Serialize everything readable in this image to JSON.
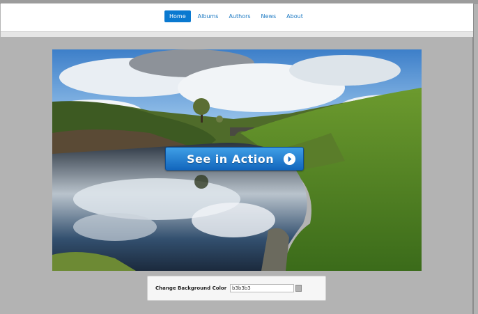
{
  "nav": {
    "items": [
      {
        "label": "Home",
        "active": true
      },
      {
        "label": "Albums",
        "active": false
      },
      {
        "label": "Authors",
        "active": false
      },
      {
        "label": "News",
        "active": false
      },
      {
        "label": "About",
        "active": false
      }
    ]
  },
  "hero": {
    "image": "landscape-river-reflection",
    "cta_label": "See in Action",
    "cta_icon": "play-circle-icon"
  },
  "background_control": {
    "label": "Change Background Color",
    "value": "b3b3b3",
    "swatch_color": "#b3b3b3"
  },
  "colors": {
    "page_background": "#b3b3b3",
    "accent": "#0a79d0",
    "link": "#1a78c2"
  }
}
